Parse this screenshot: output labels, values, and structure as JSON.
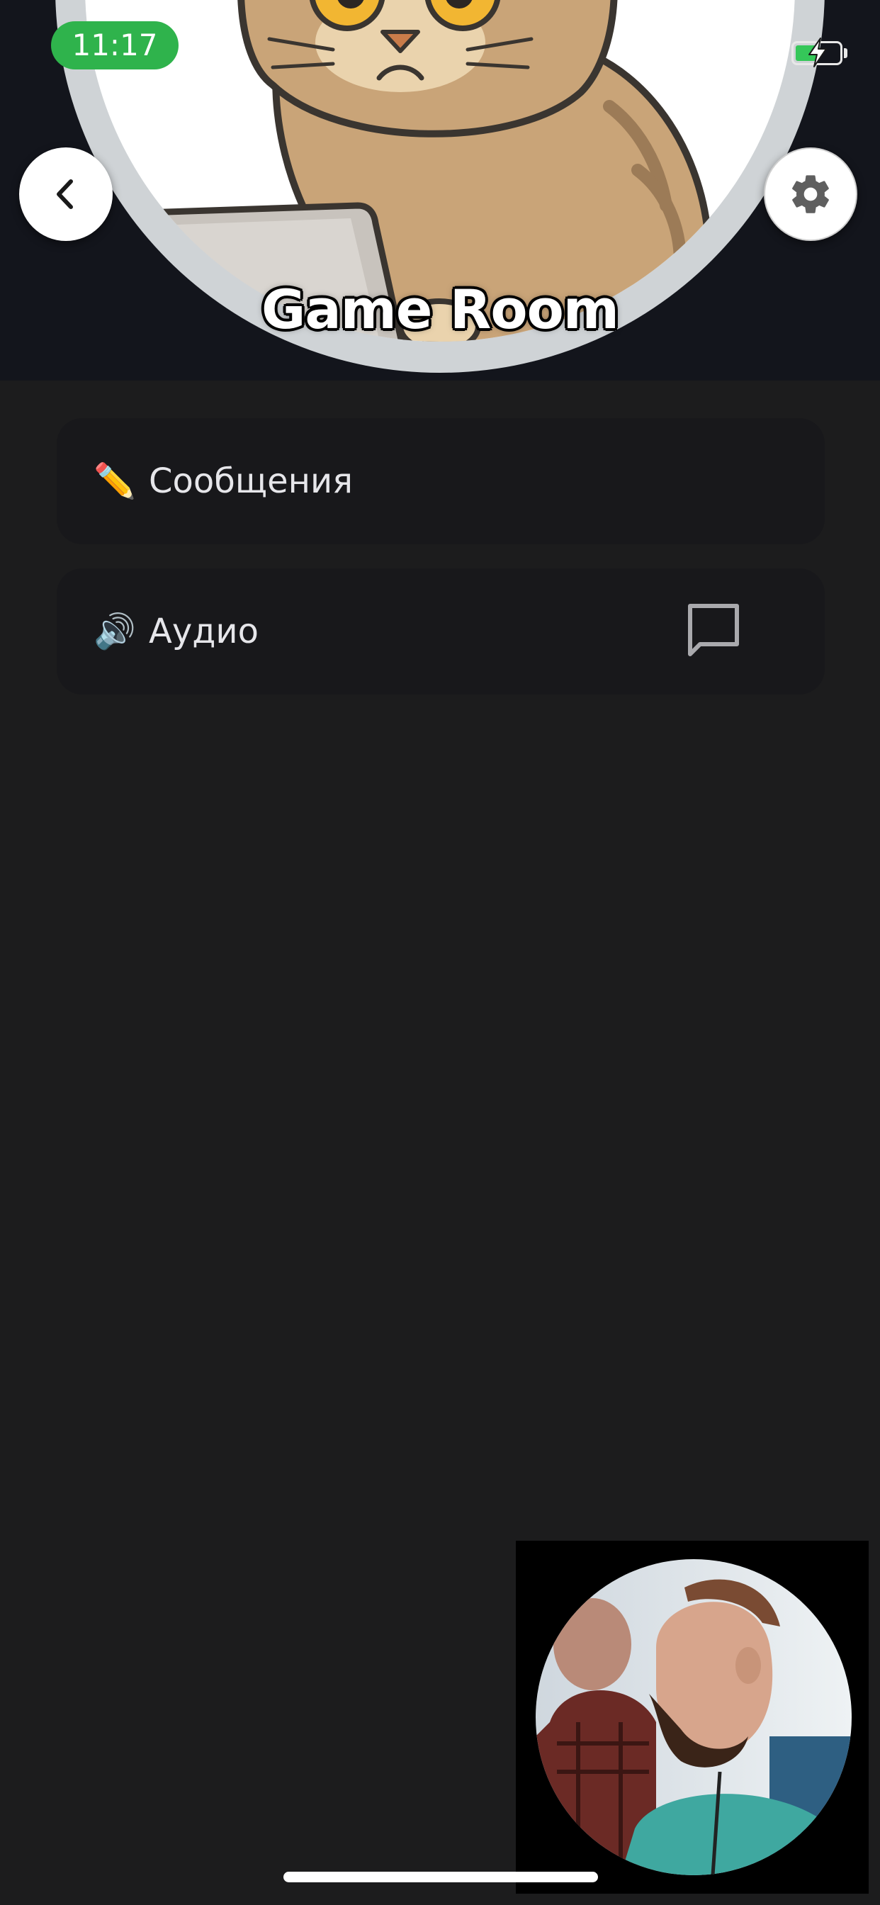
{
  "status_bar": {
    "time": "11:17",
    "battery_state": "charging",
    "icons": [
      "wifi-icon",
      "battery-icon",
      "bolt-icon"
    ]
  },
  "header": {
    "room_title": "Game Room",
    "avatar": "cat-with-laptop",
    "back_icon": "chevron-left-icon",
    "settings_icon": "gear-icon"
  },
  "channels": [
    {
      "emoji": "✏️",
      "icon": "pencil-icon",
      "label": "Сообщения"
    },
    {
      "emoji": "🔊",
      "icon": "speaker-icon",
      "label": "Аудио",
      "action_icon": "chat-bubble-icon"
    }
  ],
  "video_overlay": {
    "content": "participant-video"
  },
  "colors": {
    "background": "#1c1c1d",
    "card": "#18181b",
    "header": "#13151c",
    "time_pill": "#2fb34c",
    "battery_fill": "#35c759",
    "text": "#e6e6ea"
  }
}
